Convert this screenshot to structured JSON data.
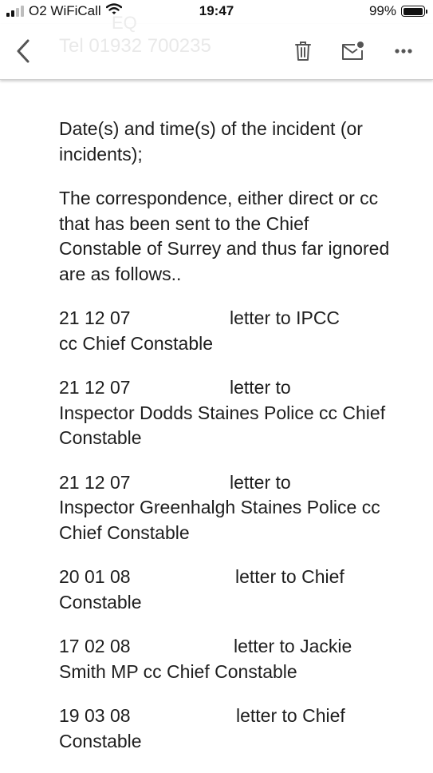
{
  "status_bar": {
    "carrier": "O2 WiFiCall",
    "time": "19:47",
    "battery_percent": "99%",
    "battery_level": 0.99,
    "icons": [
      "signal-icon",
      "wifi-icon",
      "battery-icon"
    ]
  },
  "toolbar": {
    "faded_header_text": "Tel 01932 700235",
    "faded_top_text": "EQ",
    "icons": [
      "back-chevron-icon",
      "trash-icon",
      "mail-unread-icon",
      "more-dots-icon"
    ]
  },
  "body": {
    "paragraphs": [
      "Date(s) and time(s) of the incident (or incidents);",
      "The correspondence, either direct or cc that has been sent to the Chief Constable of Surrey and thus far ignored are as follows.."
    ],
    "entries": [
      {
        "date": "21 12 07",
        "first": "letter to IPCC",
        "rest": "cc Chief Constable"
      },
      {
        "date": "21 12 07",
        "first": "letter to",
        "rest": "Inspector Dodds Staines Police cc Chief Constable"
      },
      {
        "date": "21 12 07",
        "first": "letter to",
        "rest": "Inspector Greenhalgh Staines Police cc Chief Constable"
      },
      {
        "date": "20 01 08",
        "first": "letter to Chief",
        "rest": "Constable"
      },
      {
        "date": "17 02 08",
        "first": "letter to Jackie",
        "rest": "Smith MP cc Chief Constable"
      },
      {
        "date": "19 03 08",
        "first": "letter to Chief",
        "rest": "Constable"
      }
    ]
  },
  "colors": {
    "text": "#1e1e1e",
    "toolbar_bg": "#ffffff",
    "icon": "#555555"
  }
}
